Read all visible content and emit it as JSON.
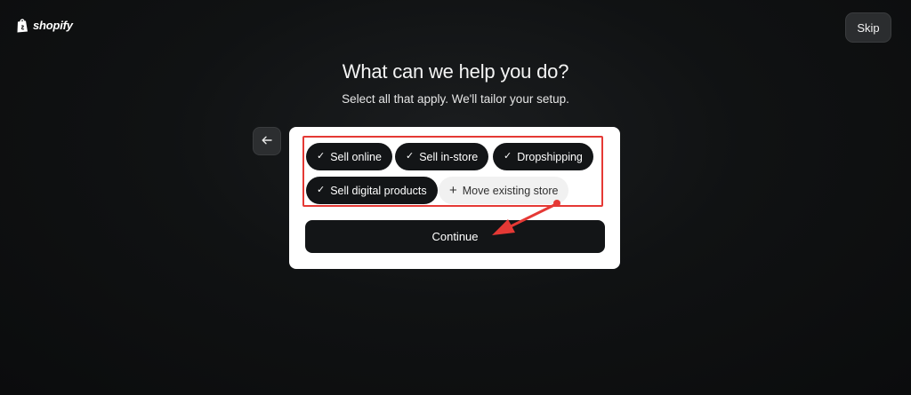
{
  "header": {
    "logo_text": "shopify",
    "logo_icon": "shopify-bag-icon",
    "skip_label": "Skip"
  },
  "main": {
    "title": "What can we help you do?",
    "subtitle": "Select all that apply. We'll tailor your setup.",
    "back_icon": "arrow-left-icon",
    "options": [
      {
        "label": "Sell online",
        "selected": true,
        "icon": "check-icon",
        "mark": "✓"
      },
      {
        "label": "Sell in-store",
        "selected": true,
        "icon": "check-icon",
        "mark": "✓"
      },
      {
        "label": "Dropshipping",
        "selected": true,
        "icon": "check-icon",
        "mark": "✓"
      },
      {
        "label": "Sell digital products",
        "selected": true,
        "icon": "check-icon",
        "mark": "✓"
      },
      {
        "label": "Move existing store",
        "selected": false,
        "icon": "plus-icon",
        "mark": "+"
      }
    ],
    "continue_label": "Continue"
  },
  "annotation": {
    "highlight_color": "#e53935",
    "arrow_color": "#e53935"
  }
}
